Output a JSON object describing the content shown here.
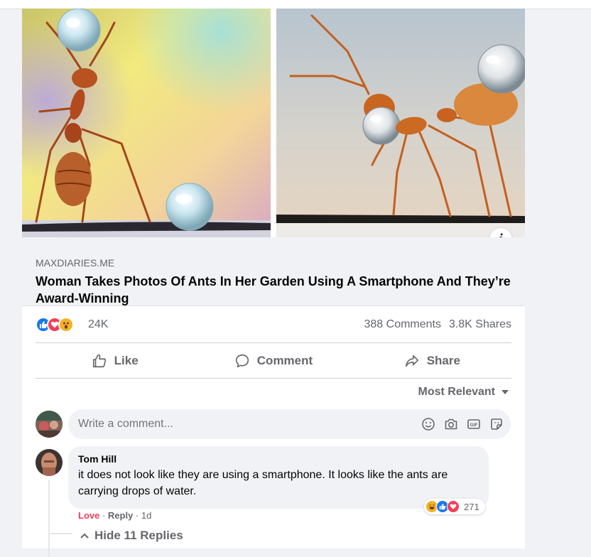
{
  "post": {
    "link": {
      "domain": "MAXDIARIES.ME",
      "title": "Woman Takes Photos Of Ants In Her Garden Using A Smartphone And They’re Award-Winning",
      "info_icon": "info-icon"
    },
    "reactions": {
      "icons": [
        "like-reaction",
        "love-reaction",
        "wow-reaction"
      ],
      "count": "24K",
      "comments": "388 Comments",
      "shares": "3.8K Shares"
    },
    "actions": {
      "like": "Like",
      "comment": "Comment",
      "share": "Share"
    },
    "sort": {
      "label": "Most Relevant"
    }
  },
  "composer": {
    "placeholder": "Write a comment...",
    "icons": [
      "emoji-icon",
      "camera-icon",
      "gif-icon",
      "sticker-icon"
    ],
    "gif_label": "GIF"
  },
  "comment": {
    "author": "Tom Hill",
    "text": "it does not look like they are using a smartphone. It looks like the ants are carrying drops of water.",
    "reaction_icons": [
      "haha-reaction",
      "like-reaction",
      "love-reaction"
    ],
    "reaction_count": "271",
    "love": "Love",
    "sep1": " · ",
    "reply": "Reply",
    "sep2": " · ",
    "time": "1d",
    "hide_replies": "Hide 11 Replies"
  },
  "colors": {
    "link_bg": "#f0f2f5",
    "secondary_text": "#65676b",
    "like_blue": "#1877f2",
    "love_red": "#f33e58",
    "wow_yellow": "#f7b125"
  }
}
